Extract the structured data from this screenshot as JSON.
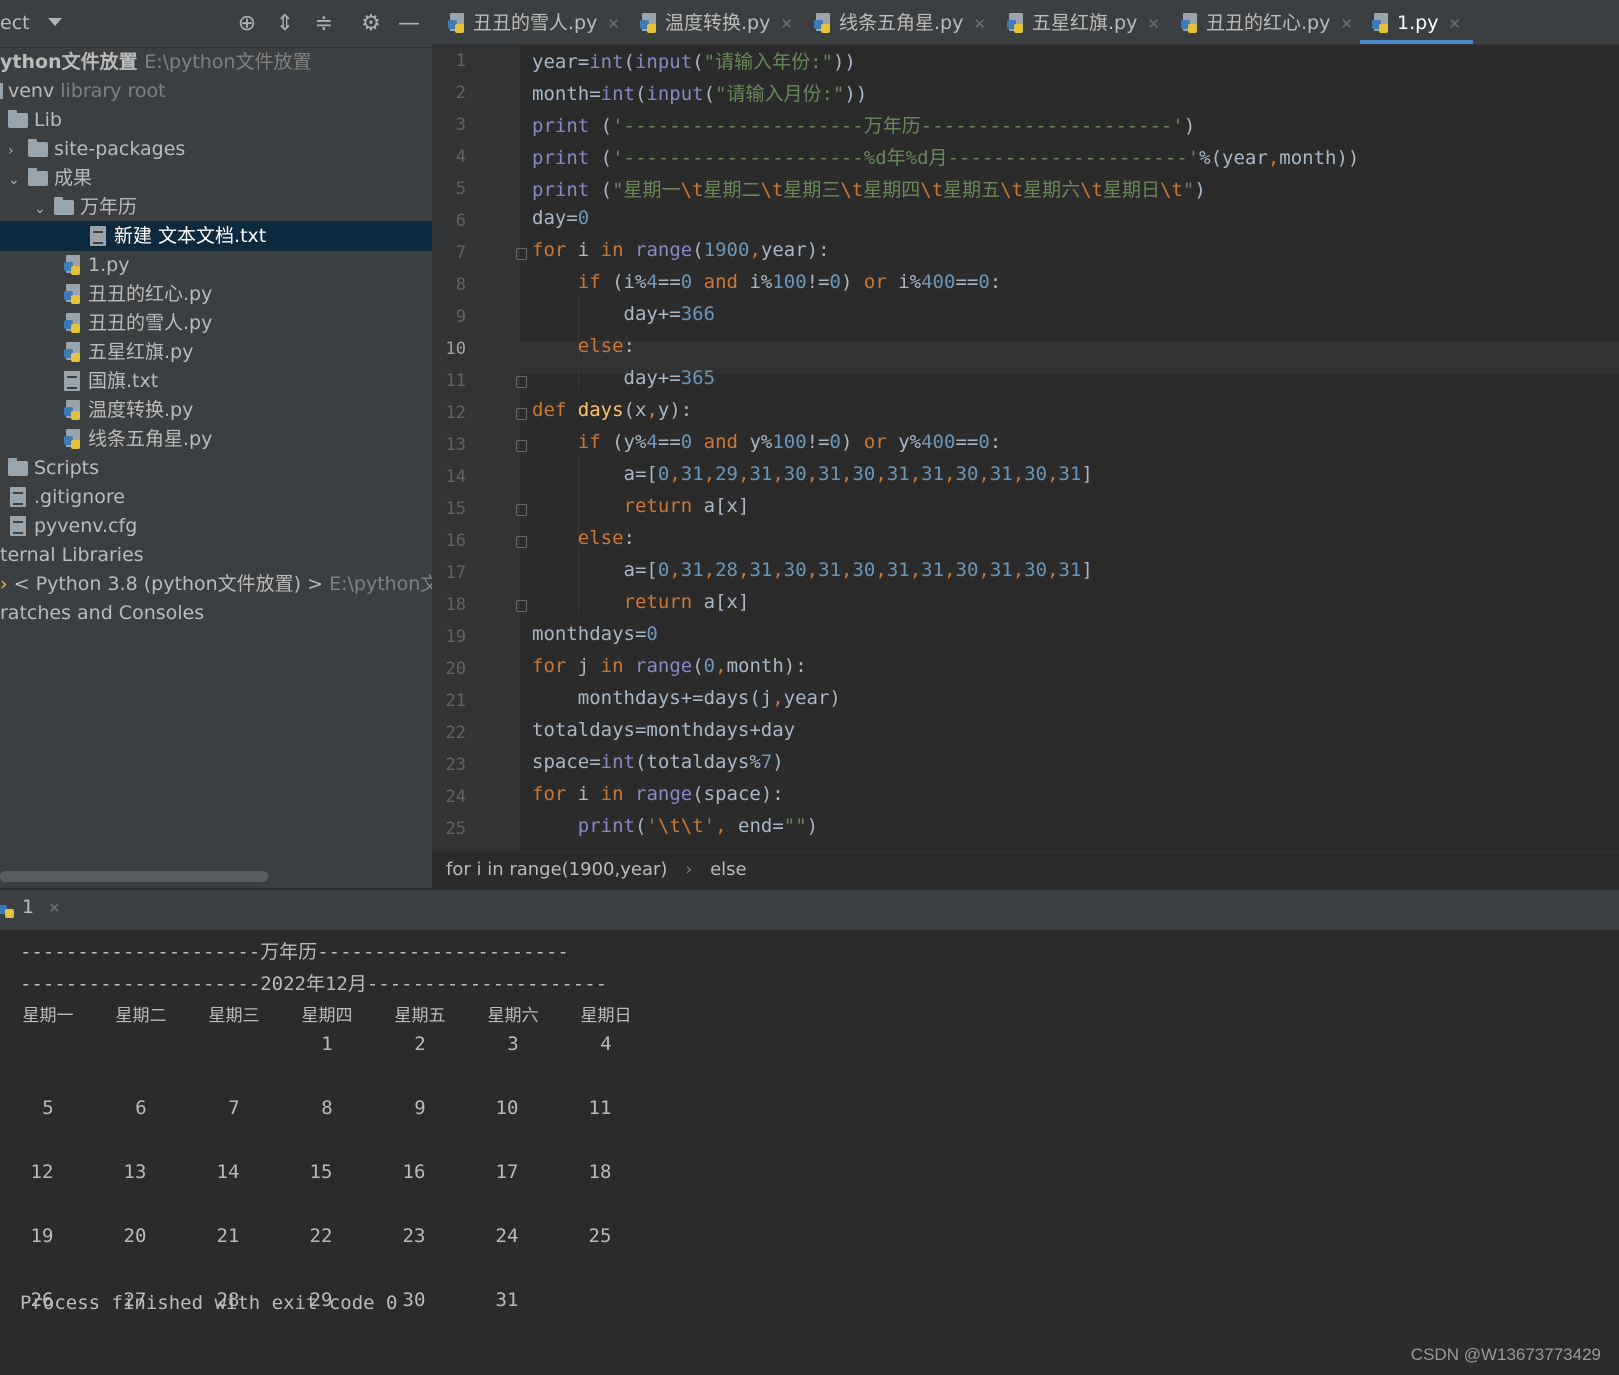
{
  "project": {
    "title": "ect",
    "tree": [
      {
        "label": "ython文件放置",
        "hint": "E:\\python文件放置",
        "kind": "root"
      },
      {
        "label": "venv",
        "hint": "library root",
        "kind": "folder"
      },
      {
        "label": "Lib",
        "kind": "folder"
      },
      {
        "label": "site-packages",
        "kind": "folder"
      },
      {
        "label": "成果",
        "kind": "folder"
      },
      {
        "label": "万年历",
        "kind": "folder"
      },
      {
        "label": "新建 文本文档.txt",
        "kind": "txt"
      },
      {
        "label": "1.py",
        "kind": "py"
      },
      {
        "label": "丑丑的红心.py",
        "kind": "py"
      },
      {
        "label": "丑丑的雪人.py",
        "kind": "py"
      },
      {
        "label": "五星红旗.py",
        "kind": "py"
      },
      {
        "label": "国旗.txt",
        "kind": "txt"
      },
      {
        "label": "温度转换.py",
        "kind": "py"
      },
      {
        "label": "线条五角星.py",
        "kind": "py"
      },
      {
        "label": "Scripts",
        "kind": "folder"
      },
      {
        "label": ".gitignore",
        "kind": "file"
      },
      {
        "label": "pyvenv.cfg",
        "kind": "file"
      },
      {
        "label": "ternal Libraries",
        "kind": "group"
      },
      {
        "label": "< Python 3.8 (python文件放置) >",
        "hint": "E:\\python文件放",
        "kind": "sdk"
      },
      {
        "label": "ratches and Consoles",
        "kind": "group"
      }
    ]
  },
  "tabs": [
    {
      "label": "丑丑的雪人.py"
    },
    {
      "label": "温度转换.py"
    },
    {
      "label": "线条五角星.py"
    },
    {
      "label": "五星红旗.py"
    },
    {
      "label": "丑丑的红心.py"
    },
    {
      "label": "1.py",
      "active": true
    }
  ],
  "editor": {
    "current_line": 10,
    "line_numbers": [
      "1",
      "2",
      "3",
      "4",
      "5",
      "6",
      "7",
      "8",
      "9",
      "10",
      "11",
      "12",
      "13",
      "14",
      "15",
      "16",
      "17",
      "18",
      "19",
      "20",
      "21",
      "22",
      "23",
      "24",
      "25"
    ],
    "lines": [
      "year=int(input(\"请输入年份:\"))",
      "month=int(input(\"请输入月份:\"))",
      "print ('---------------------万年历----------------------')",
      "print ('---------------------%d年%d月---------------------'%(year,month))",
      "print (\"星期一\\t星期二\\t星期三\\t星期四\\t星期五\\t星期六\\t星期日\\t\")",
      "day=0",
      "for i in range(1900,year):",
      "    if (i%4==0 and i%100!=0) or i%400==0:",
      "        day+=366",
      "    else:",
      "        day+=365",
      "def days(x,y):",
      "    if (y%4==0 and y%100!=0) or y%400==0:",
      "        a=[0,31,29,31,30,31,30,31,31,30,31,30,31]",
      "        return a[x]",
      "    else:",
      "        a=[0,31,28,31,30,31,30,31,31,30,31,30,31]",
      "        return a[x]",
      "monthdays=0",
      "for j in range(0,month):",
      "    monthdays+=days(j,year)",
      "totaldays=monthdays+day",
      "space=int(totaldays%7)",
      "for i in range(space):",
      "    print('\\t\\t', end=\"\")"
    ]
  },
  "breadcrumb": {
    "first": "for i in range(1900,year)",
    "sep": "›",
    "second": "else"
  },
  "run": {
    "tab_label": "1",
    "header1": "---------------------万年历----------------------",
    "header2": "---------------------2022年12月---------------------",
    "weekdays": [
      "星期一",
      "星期二",
      "星期三",
      "星期四",
      "星期五",
      "星期六",
      "星期日"
    ],
    "weeks": [
      [
        "",
        "",
        "",
        "1",
        "2",
        "3",
        "4"
      ],
      [
        "5",
        "6",
        "7",
        "8",
        "9",
        "10",
        "11"
      ],
      [
        "12",
        "13",
        "14",
        "15",
        "16",
        "17",
        "18"
      ],
      [
        "19",
        "20",
        "21",
        "22",
        "23",
        "24",
        "25"
      ],
      [
        "26",
        "27",
        "28",
        "29",
        "30",
        "31",
        ""
      ]
    ],
    "finish": "Process finished with exit code 0"
  },
  "watermark": "CSDN @W13673773429",
  "colors": {
    "background": "#2b2b2b",
    "panel": "#3c3f41",
    "selection": "#0d293e",
    "keyword": "#cc7832",
    "string": "#6a8759",
    "number": "#6897bb",
    "function": "#ffc66d",
    "builtin": "#8888c6",
    "accent": "#4a88c7"
  }
}
